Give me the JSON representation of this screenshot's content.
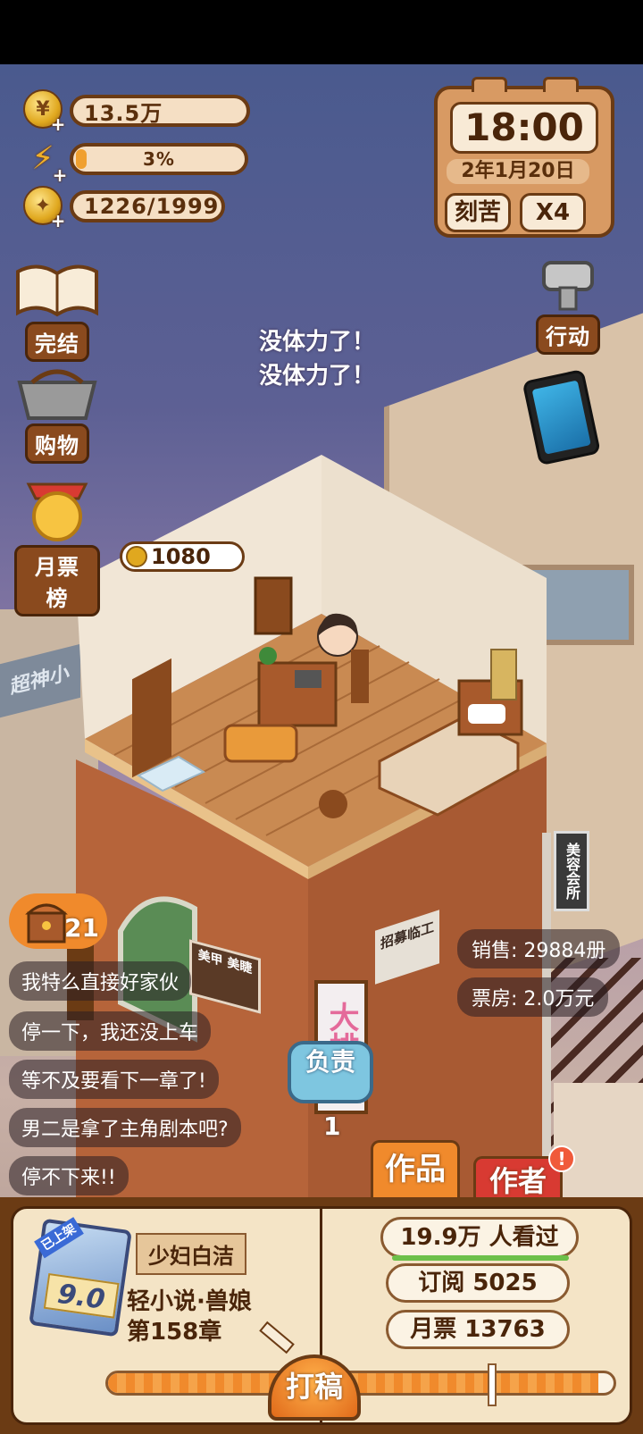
{
  "resources": {
    "coins": "13.5万",
    "energy": "3%",
    "ideas": "1226/1999",
    "energy_level": 0.03,
    "ideas_level": 0.613
  },
  "clock": {
    "time": "18:00",
    "date": "2年1月20日",
    "mode": "刻苦",
    "speed": "X4"
  },
  "left_menu": {
    "finish": "完结",
    "shopping": "购物",
    "ranking": "月票榜"
  },
  "right_menu": {
    "action": "行动"
  },
  "status_text": [
    "没体力了！",
    "没体力了！"
  ],
  "coin_bubble": "1080",
  "chest_count": "21",
  "comments": [
    "我特么直接好家伙",
    "停一下，我还没上车",
    "等不及要看下一章了!",
    "男二是拿了主角剧本吧?",
    "停不下来!!"
  ],
  "stats": {
    "sales": "销售: 29884册",
    "box_office": "票房: 2.0万元"
  },
  "responsible_button": "负责",
  "responsible_count": "1",
  "signs": {
    "left_wall": "美甲 美睫",
    "recruit": "招募临工",
    "vertical": "大排档",
    "hanging": "美容会所",
    "background": "超神小"
  },
  "tabs": {
    "works": "作品",
    "author": "作者",
    "author_alert": "!"
  },
  "book": {
    "badge": "已上架",
    "score": "9.0",
    "character": "少妇白洁",
    "genre": "轻小说·兽娘",
    "chapter": "第158章",
    "viewers": "19.9万 人看过",
    "subscribe": "订阅 5025",
    "monthly_votes": "月票 13763",
    "write_button": "打稿",
    "progress": 0.97
  },
  "colors": {
    "wood_dark": "#6b3b14",
    "wood_mid": "#8a4a1e",
    "paper": "#f4e4c6",
    "accent_red": "#d83a32",
    "accent_orange": "#f08a2c"
  }
}
